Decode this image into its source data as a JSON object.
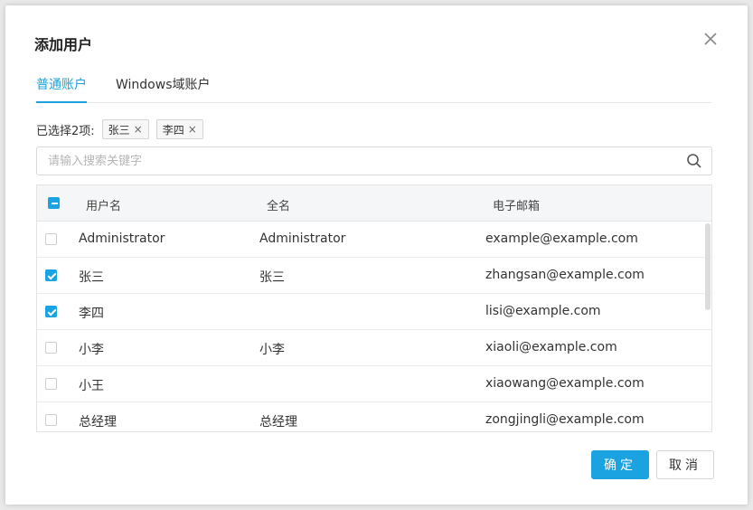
{
  "dialog": {
    "title": "添加用户",
    "close_icon": "close-icon"
  },
  "tabs": [
    {
      "label": "普通账户",
      "active": true
    },
    {
      "label": "Windows域账户",
      "active": false
    }
  ],
  "selection": {
    "label": "已选择2项:",
    "chips": [
      {
        "label": "张三",
        "remove": "×"
      },
      {
        "label": "李四",
        "remove": "×"
      }
    ]
  },
  "search": {
    "placeholder": "请输入搜索关键字",
    "value": "",
    "icon": "search-icon"
  },
  "table": {
    "header": {
      "select_all_state": "indeterminate",
      "columns": [
        "用户名",
        "全名",
        "电子邮箱"
      ]
    },
    "rows": [
      {
        "checked": false,
        "username": "Administrator",
        "fullname": "Administrator",
        "email": "example@example.com"
      },
      {
        "checked": true,
        "username": "张三",
        "fullname": "张三",
        "email": "zhangsan@example.com"
      },
      {
        "checked": true,
        "username": "李四",
        "fullname": "",
        "email": "lisi@example.com"
      },
      {
        "checked": false,
        "username": "小李",
        "fullname": "小李",
        "email": "xiaoli@example.com"
      },
      {
        "checked": false,
        "username": "小王",
        "fullname": "",
        "email": "xiaowang@example.com"
      },
      {
        "checked": false,
        "username": "总经理",
        "fullname": "总经理",
        "email": "zongjingli@example.com"
      }
    ]
  },
  "buttons": {
    "ok": "确定",
    "cancel": "取消"
  },
  "colors": {
    "accent": "#1aa3e0"
  }
}
